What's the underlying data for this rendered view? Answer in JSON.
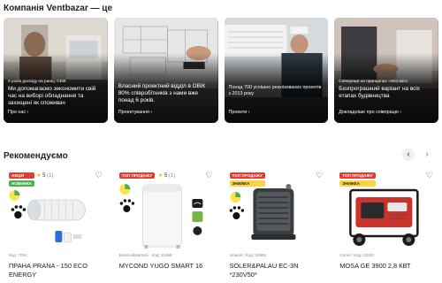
{
  "company_section": {
    "title": "Компанія Ventbazar — це",
    "cards": [
      {
        "lead": "9 років досвіду на ринку ОВіК",
        "text": "Ми допомагаємо зекономити свій час на виборі обладнання та захищені як споживач",
        "link": "Про нас  ›"
      },
      {
        "lead": "",
        "text": "Власний проектний відділ в ОВіК",
        "text2": "80% співробітників з нами вже понад 6 років.",
        "link": "Проектування  ›"
      },
      {
        "lead": "",
        "text": "Понад 700 успішно реалізованих проектів з 2013 року",
        "link": "Проекти  ›"
      },
      {
        "lead": "Співпраця на принципах «Win-win»",
        "text": "Безпрограшний варіант на всіх етапах будівництва",
        "link": "Докладніше про співпрацю  ›"
      }
    ]
  },
  "recommended": {
    "title": "Рекомендуємо",
    "prev_icon": "‹",
    "next_icon": "›",
    "products": [
      {
        "badges": [
          "АКЦІЯ",
          "НОВИНКА"
        ],
        "rating": "5",
        "reviews": "(1)",
        "sku": "Код: 7091",
        "name": "ПРАНА PRANA - 150 ECO ENERGY"
      },
      {
        "badges": [
          "ТОП ПРОДАЖУ"
        ],
        "rating": "5",
        "reviews": "(1)",
        "sku": "Вологобувателі · Код: 11499",
        "name": "MYCOND YUGO SMART 16"
      },
      {
        "badges": [
          "ТОП ПРОДАЖУ",
          "ЗНИЖКА"
        ],
        "rating": "",
        "reviews": "",
        "sku": "Іспанія / Код: 10984",
        "name": "SOLER&PALAU EC-3N *230V50*"
      },
      {
        "badges": [
          "ТОП ПРОДАЖУ",
          "ЗНИЖКА"
        ],
        "rating": "",
        "reviews": "",
        "sku": "Італія / Код: 11592",
        "name": "MOSA GE 3900 2,8 КВТ"
      }
    ]
  },
  "colors": {
    "accent_red": "#e63b2e",
    "badge_green": "#4caf50",
    "badge_yellow": "#ffd43b",
    "star": "#f5b400"
  },
  "icons": {
    "heart": "heart-icon",
    "star": "star-icon",
    "arrow_prev": "chevron-left-icon",
    "arrow_next": "chevron-right-icon"
  }
}
